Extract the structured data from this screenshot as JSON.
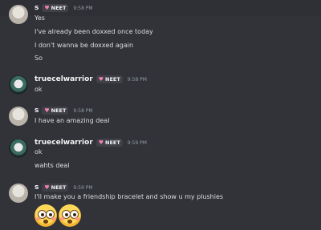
{
  "messages": [
    {
      "author": "s",
      "badge": "NEET",
      "time": "9:58 PM",
      "lines": [
        "Yes",
        "I've already been doxxed once today",
        "I don't wanna be doxxed again",
        "So"
      ]
    },
    {
      "author": "truecelwarrior",
      "badge": "NEET",
      "time": "9:58 PM",
      "lines": [
        "ok"
      ]
    },
    {
      "author": "s",
      "badge": "NEET",
      "time": "9:58 PM",
      "lines": [
        "I have an amazing deal"
      ]
    },
    {
      "author": "truecelwarrior",
      "badge": "NEET",
      "time": "9:59 PM",
      "lines": [
        "ok",
        "wahts deal"
      ]
    },
    {
      "author": "s",
      "badge": "NEET",
      "time": "9:59 PM",
      "lines": [
        "I'll make you a friendship bracelet and show u my plushies"
      ],
      "emojis": [
        "flushed-face",
        "flushed-face"
      ]
    }
  ]
}
